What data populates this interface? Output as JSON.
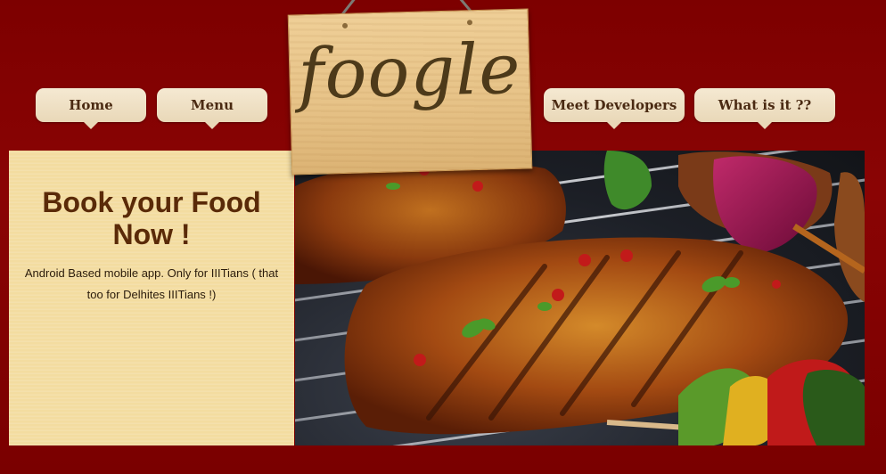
{
  "nav": {
    "home": "Home",
    "menu": "Menu",
    "meet_developers": "Meet Developers",
    "what_is_it": "What is it ??"
  },
  "sign": {
    "logo_text": "foogle"
  },
  "info": {
    "headline": "Book your Food Now !",
    "description": "Android Based mobile app. Only for IIITians ( that too for Delhites IIITians !)"
  },
  "colors": {
    "background": "#7d0000",
    "tab_bg": "#f0e2c8",
    "tab_text": "#4a2a12",
    "panel_bg": "#f3dca0",
    "headline": "#5a2a08"
  },
  "hero": {
    "image": "grilled-steak-photo"
  }
}
